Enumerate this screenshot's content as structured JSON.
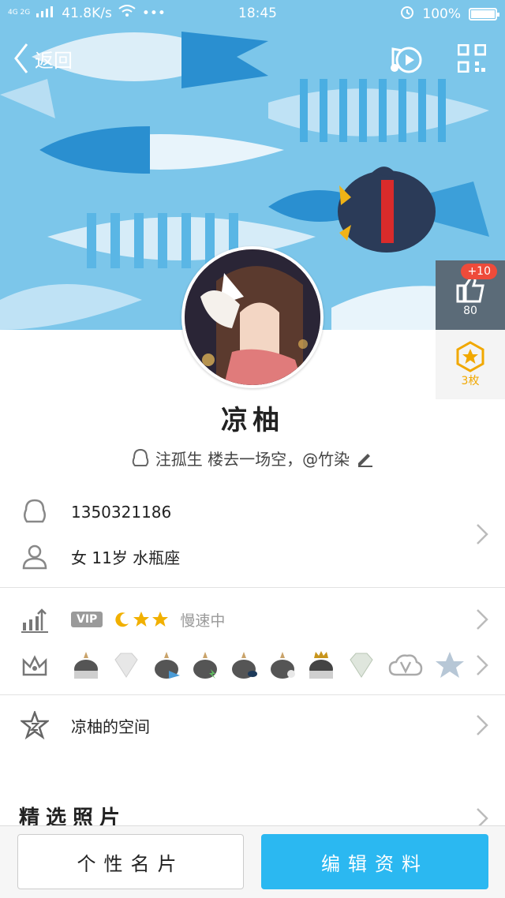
{
  "status_bar": {
    "network": "4G 2G",
    "speed": "41.8K/s",
    "time": "18:45",
    "battery": "100%"
  },
  "nav": {
    "back_label": "返回"
  },
  "side_panel": {
    "like_badge": "+10",
    "like_count": "80",
    "medal_label": "3枚"
  },
  "profile": {
    "name": "凉柚",
    "signature": "注孤生 楼去一场空，@竹染"
  },
  "info": {
    "qq_number": "1350321186",
    "basic": "女  11岁  水瓶座"
  },
  "level": {
    "vip_label": "VIP",
    "speed_text": "慢速中"
  },
  "space": {
    "label": "凉柚的空间"
  },
  "photos": {
    "title": "精选照片"
  },
  "buttons": {
    "card": "个性名片",
    "edit": "编辑资料"
  }
}
